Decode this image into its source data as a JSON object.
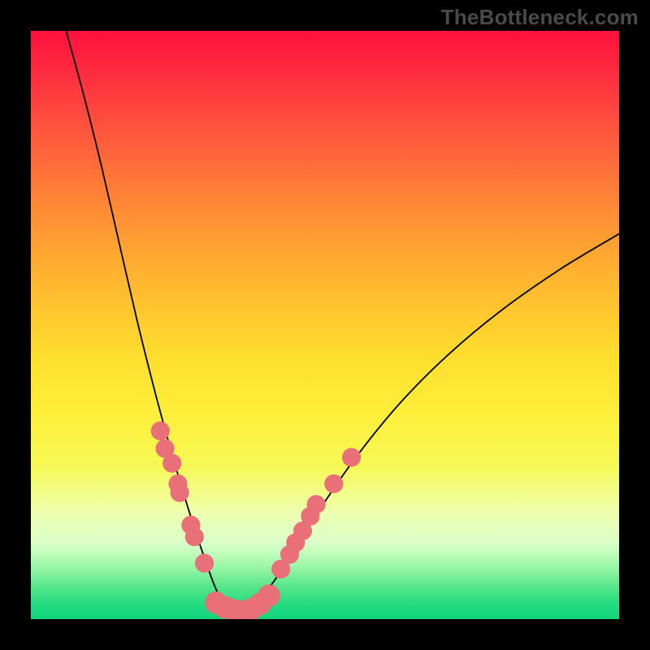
{
  "watermark": "TheBottleneck.com",
  "colors": {
    "frame": "#000000",
    "curve": "#000000",
    "marker_fill": "#e96f78",
    "gradient_top": "#ff103d",
    "gradient_bottom": "#14d57a"
  },
  "chart_data": {
    "type": "line",
    "title": "",
    "xlabel": "",
    "ylabel": "",
    "xlim": [
      0,
      100
    ],
    "ylim": [
      0,
      100
    ],
    "note": "Axes are unlabelled in source. x left→right, y bottom→top, both 0–100. Curve depicts V-shaped bottleneck; minimum (green zone) near x≈35.",
    "curve": [
      {
        "x": 6.0,
        "y": 100.0
      },
      {
        "x": 9.0,
        "y": 89.0
      },
      {
        "x": 12.0,
        "y": 77.0
      },
      {
        "x": 15.0,
        "y": 64.0
      },
      {
        "x": 18.0,
        "y": 51.0
      },
      {
        "x": 21.0,
        "y": 39.0
      },
      {
        "x": 24.0,
        "y": 28.0
      },
      {
        "x": 27.0,
        "y": 18.0
      },
      {
        "x": 30.0,
        "y": 9.0
      },
      {
        "x": 32.0,
        "y": 4.0
      },
      {
        "x": 34.0,
        "y": 1.5
      },
      {
        "x": 36.0,
        "y": 1.2
      },
      {
        "x": 38.0,
        "y": 2.5
      },
      {
        "x": 41.0,
        "y": 6.0
      },
      {
        "x": 45.0,
        "y": 12.0
      },
      {
        "x": 50.0,
        "y": 20.0
      },
      {
        "x": 56.0,
        "y": 28.5
      },
      {
        "x": 63.0,
        "y": 37.0
      },
      {
        "x": 71.0,
        "y": 45.0
      },
      {
        "x": 80.0,
        "y": 52.5
      },
      {
        "x": 90.0,
        "y": 59.5
      },
      {
        "x": 100.0,
        "y": 65.5
      }
    ],
    "markers_left": [
      {
        "x": 22.0,
        "y": 32.0
      },
      {
        "x": 22.8,
        "y": 29.0
      },
      {
        "x": 24.0,
        "y": 26.5
      },
      {
        "x": 25.0,
        "y": 23.0
      },
      {
        "x": 25.3,
        "y": 21.5
      },
      {
        "x": 27.2,
        "y": 16.0
      },
      {
        "x": 27.8,
        "y": 14.0
      },
      {
        "x": 29.5,
        "y": 9.5
      }
    ],
    "markers_right": [
      {
        "x": 42.5,
        "y": 8.5
      },
      {
        "x": 44.0,
        "y": 11.0
      },
      {
        "x": 45.0,
        "y": 13.0
      },
      {
        "x": 46.2,
        "y": 15.0
      },
      {
        "x": 47.5,
        "y": 17.5
      },
      {
        "x": 48.5,
        "y": 19.5
      },
      {
        "x": 51.5,
        "y": 23.0
      },
      {
        "x": 54.5,
        "y": 27.5
      }
    ],
    "markers_bottom": [
      {
        "x": 31.5,
        "y": 2.8
      },
      {
        "x": 33.0,
        "y": 2.0
      },
      {
        "x": 34.5,
        "y": 1.5
      },
      {
        "x": 36.0,
        "y": 1.3
      },
      {
        "x": 37.5,
        "y": 1.7
      },
      {
        "x": 39.0,
        "y": 2.6
      },
      {
        "x": 40.5,
        "y": 4.0
      }
    ],
    "marker_radius_large": 1.6,
    "marker_radius_bottom": 1.9
  }
}
